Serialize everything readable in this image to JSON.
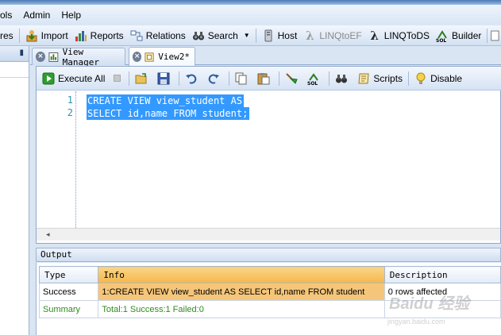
{
  "menu": {
    "items": [
      "ols",
      "Admin",
      "Help"
    ]
  },
  "toolbar": {
    "items": [
      {
        "label": "res",
        "icon": "none"
      },
      {
        "label": "Import",
        "icon": "import-icon"
      },
      {
        "label": "Reports",
        "icon": "reports-icon"
      },
      {
        "label": "Relations",
        "icon": "relations-icon"
      },
      {
        "label": "Search",
        "icon": "binoculars-icon"
      },
      {
        "label": "Host",
        "icon": "host-icon"
      },
      {
        "label": "LINQtoEF",
        "icon": "lambda-icon"
      },
      {
        "label": "LINQToDS",
        "icon": "lambda-icon"
      },
      {
        "label": "Builder",
        "icon": "sql-builder-icon"
      }
    ]
  },
  "tabs": [
    {
      "label": "View Manager"
    },
    {
      "label": "View2*"
    }
  ],
  "editor": {
    "execute_all_label": "Execute All",
    "scripts_label": "Scripts",
    "disable_label": "Disable",
    "line_numbers": [
      "1",
      "2"
    ],
    "lines": [
      "CREATE VIEW view_student AS",
      "SELECT id,name FROM student;"
    ]
  },
  "output": {
    "title": "Output",
    "columns": [
      "Type",
      "Info",
      "Description"
    ],
    "rows": [
      {
        "type": "Success",
        "info": "1:CREATE VIEW view_student AS SELECT id,name FROM student",
        "description": "0 rows affected"
      },
      {
        "type": "Summary",
        "info": "Total:1 Success:1 Failed:0",
        "description": ""
      }
    ]
  },
  "watermark": {
    "line1": "Baidu 经验",
    "line2": "jingyan.baidu.com"
  },
  "colors": {
    "selection": "#3399ff",
    "info_header": "#f5b74a",
    "summary_text": "#2e8b1e",
    "line_number": "#2b91af"
  }
}
